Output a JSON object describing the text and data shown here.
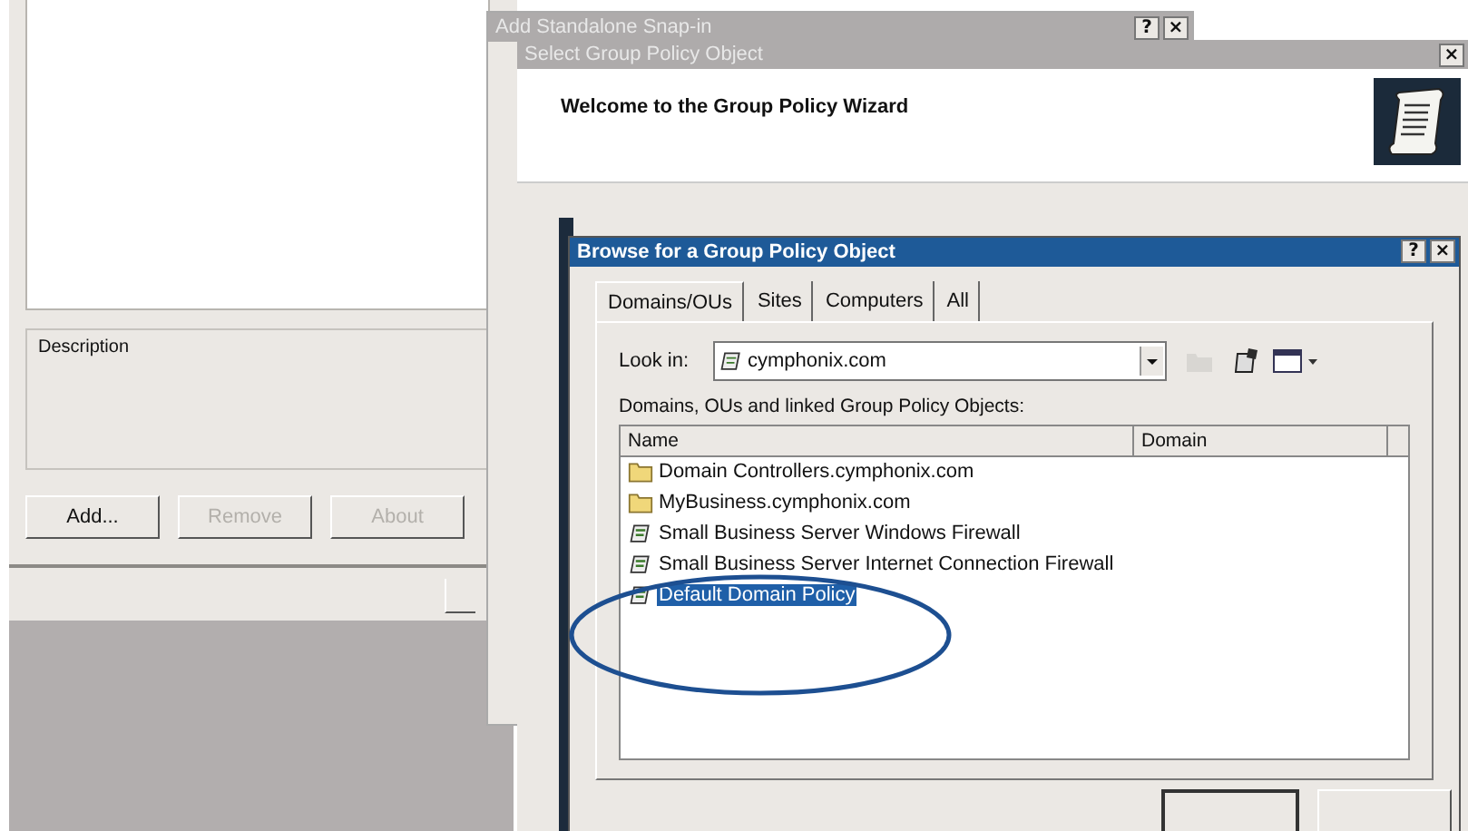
{
  "background_window": {
    "description_label": "Description",
    "buttons": [
      {
        "label": "Add...",
        "disabled": false
      },
      {
        "label": "Remove",
        "disabled": true
      },
      {
        "label": "About",
        "disabled": true
      }
    ]
  },
  "snapin_window": {
    "title": "Add Standalone Snap-in",
    "title_buttons": [
      "?",
      "×"
    ]
  },
  "gpo_window": {
    "title": "Select Group Policy Object",
    "close": "×",
    "heading": "Welcome to the Group Policy Wizard"
  },
  "browse_dialog": {
    "title": "Browse for a Group Policy Object",
    "title_buttons": [
      "?",
      "×"
    ],
    "tabs": [
      {
        "label": "Domains/OUs",
        "selected": true
      },
      {
        "label": "Sites",
        "selected": false
      },
      {
        "label": "Computers",
        "selected": false
      },
      {
        "label": "All",
        "selected": false
      }
    ],
    "look_in_label": "Look in:",
    "look_in_value": "cymphonix.com",
    "list_label": "Domains, OUs and linked Group Policy Objects:",
    "columns": [
      "Name",
      "Domain"
    ],
    "items": [
      {
        "name": "Domain Controllers.cymphonix.com",
        "kind": "folder",
        "selected": false
      },
      {
        "name": "MyBusiness.cymphonix.com",
        "kind": "folder",
        "selected": false
      },
      {
        "name": "Small Business Server Windows Firewall",
        "kind": "policy",
        "selected": false
      },
      {
        "name": "Small Business Server Internet Connection Firewall",
        "kind": "policy",
        "selected": false
      },
      {
        "name": "Default Domain Policy",
        "kind": "policy",
        "selected": true
      }
    ]
  }
}
